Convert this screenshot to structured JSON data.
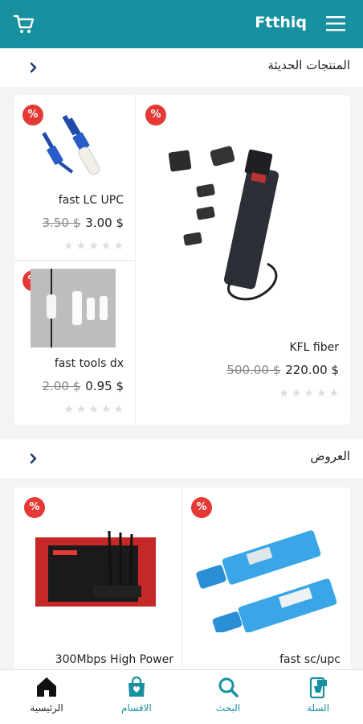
{
  "app": {
    "title": "Ftthiq"
  },
  "sections": {
    "new_products": "المنتجات الحديثة",
    "offers": "العروض"
  },
  "badge": "%",
  "new_products": [
    {
      "name": "KFL fiber",
      "old_price": "500.00 $",
      "price": "220.00 $",
      "rating": 0
    },
    {
      "name": "fast LC UPC",
      "old_price": "3.50 $",
      "price": "3.00 $",
      "rating": 0
    },
    {
      "name": "fast tools dx",
      "old_price": "2.00 $",
      "price": "0.95 $",
      "rating": 0
    }
  ],
  "offers": [
    {
      "name": "fast sc/upc"
    },
    {
      "name": "300Mbps High Power"
    }
  ],
  "bottom_nav": [
    {
      "label": "الرئيسية",
      "icon": "home-icon",
      "active": true
    },
    {
      "label": "الاقسام",
      "icon": "shopping-bag-icon"
    },
    {
      "label": "البحث",
      "icon": "search-icon"
    },
    {
      "label": "السلة",
      "icon": "cart-phone-icon"
    }
  ],
  "colors": {
    "primary": "#1790a0",
    "badge": "#e53935"
  }
}
